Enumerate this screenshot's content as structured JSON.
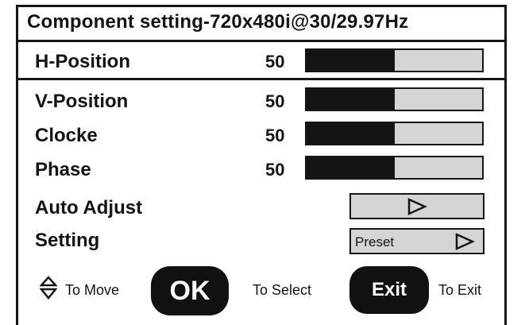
{
  "title": "Component setting-720x480i@30/29.97Hz",
  "rows": [
    {
      "label": "H-Position",
      "value": "50",
      "level_percent": 50
    },
    {
      "label": "V-Position",
      "value": "50",
      "level_percent": 50
    },
    {
      "label": "Clocke",
      "value": "50",
      "level_percent": 50
    },
    {
      "label": "Phase",
      "value": "50",
      "level_percent": 50
    }
  ],
  "auto_adjust": {
    "label": "Auto Adjust"
  },
  "setting": {
    "label": "Setting",
    "value": "Preset"
  },
  "footer": {
    "move_text": "To Move",
    "ok_label": "OK",
    "select_text": "To Select",
    "exit_label": "Exit",
    "exit_text": "To Exit"
  },
  "colors": {
    "bar_fill": "#141414",
    "bar_empty": "#d5d5d5",
    "border": "#161616",
    "background": "#ffffff"
  },
  "icons": {
    "navigate": "up-down-arrows-icon",
    "activate": "play-triangle-icon"
  }
}
